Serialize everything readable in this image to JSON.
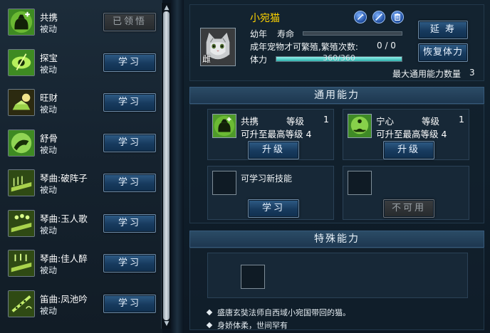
{
  "skill_list": {
    "items": [
      {
        "name": "共携",
        "type": "被动",
        "button": "已领悟",
        "disabled": true
      },
      {
        "name": "探宝",
        "type": "被动",
        "button": "学习",
        "disabled": false
      },
      {
        "name": "旺财",
        "type": "被动",
        "button": "学习",
        "disabled": false
      },
      {
        "name": "舒骨",
        "type": "被动",
        "button": "学习",
        "disabled": false
      },
      {
        "name": "琴曲:破阵子",
        "type": "被动",
        "button": "学习",
        "disabled": false
      },
      {
        "name": "琴曲:玉人歌",
        "type": "被动",
        "button": "学习",
        "disabled": false
      },
      {
        "name": "琴曲:佳人醉",
        "type": "被动",
        "button": "学习",
        "disabled": false
      },
      {
        "name": "笛曲:凤池吟",
        "type": "被动",
        "button": "学习",
        "disabled": false
      }
    ]
  },
  "pet": {
    "name": "小宛猫",
    "gender": "雌",
    "age_label": "幼年",
    "life_label": "寿命",
    "breed_text": "成年宠物才可繁殖,繁殖次数:",
    "breed_count": "0 / 0",
    "stamina_label": "体力",
    "stamina_text": "360/360",
    "stamina_fraction": 1.0,
    "life_fraction": 1.0,
    "extend_button": "延 寿",
    "restore_button": "恢复体力",
    "max_ability_label": "最大通用能力数量",
    "max_ability_value": "3",
    "tool_icons": [
      "feather-icon",
      "stick-icon",
      "trash-icon"
    ]
  },
  "general_ability": {
    "title": "通用能力",
    "cards": [
      {
        "name": "共携",
        "level_label": "等级",
        "level": "1",
        "max_label": "可升至最高等级",
        "max": "4",
        "button": "升级"
      },
      {
        "name": "宁心",
        "level_label": "等级",
        "level": "1",
        "max_label": "可升至最高等级",
        "max": "4",
        "button": "升级"
      }
    ],
    "learn_new_label": "可学习新技能",
    "learn_button": "学习",
    "unavailable_button": "不可用"
  },
  "special_ability": {
    "title": "特殊能力",
    "descriptions": [
      "盛唐玄奘法师自西域小宛国带回的猫。",
      "身娇体柔，世间罕有"
    ]
  }
}
